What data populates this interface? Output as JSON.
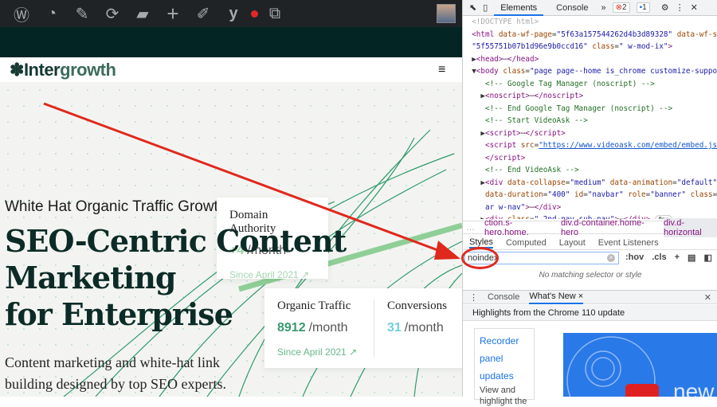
{
  "wp_admin_bar": {
    "icons": [
      "wordpress-icon",
      "dashboard-icon",
      "customize-brush-icon",
      "updates-icon",
      "comments-icon",
      "new-icon",
      "edit-icon",
      "yoast-icon",
      "notification-dot",
      "duplicate-icon"
    ]
  },
  "site": {
    "logo_a": "Inter",
    "logo_b": "growth",
    "subtitle": "White Hat Organic Traffic Growth",
    "headline": [
      "SEO-Centric Content",
      "Marketing",
      "for Enterprise"
    ],
    "description": [
      "Content marketing and white-hat link",
      "building designed by top SEO experts."
    ],
    "cards": {
      "domain_authority": {
        "title": "Domain Authority",
        "value": "+4",
        "unit": "/month",
        "since": "Since April 2021"
      },
      "organic_traffic": {
        "title": "Organic Traffic",
        "value": "8912",
        "unit": "/month",
        "since": "Since April 2021"
      },
      "conversions": {
        "title": "Conversions",
        "value": "31",
        "unit": "/month"
      }
    }
  },
  "devtools": {
    "tabs": [
      "Elements",
      "Console"
    ],
    "more": "»",
    "errors": "2",
    "messages": "1",
    "breadcrumbs": [
      "ction.s-hero.home.",
      "div.d-container.home-hero",
      "div.d-horizontal"
    ],
    "styles_tabs": [
      "Styles",
      "Computed",
      "Layout",
      "Event Listeners"
    ],
    "filter_value": "noindex",
    "hov": ":hov",
    "cls": ".cls",
    "no_match": "No matching selector or style",
    "drawer_tabs": [
      "Console",
      "What's New"
    ],
    "highlights": "Highlights from the Chrome 110 update",
    "whatsnew": {
      "link1": "Recorder",
      "link2": "panel",
      "link3": "updates",
      "text": "View and highlight the",
      "video_text": "new"
    }
  },
  "colors": {
    "accent": "#1a73e8",
    "annotation": "#e0281d",
    "brand_green": "#3a9a6e"
  }
}
